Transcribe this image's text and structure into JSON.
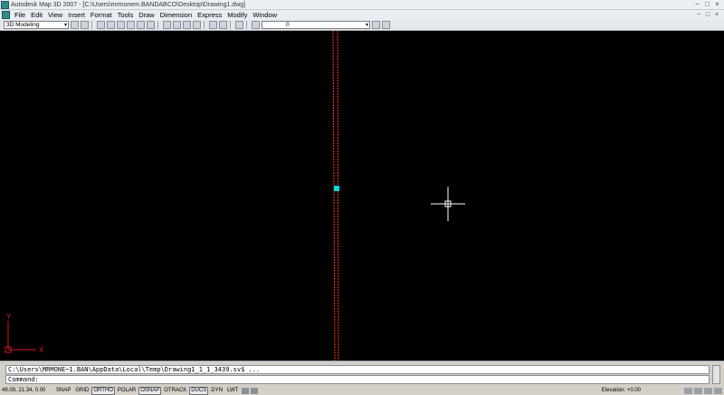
{
  "window": {
    "title": "Autodesk Map 3D 2007 - [C:\\Users\\mrmonem.BANDABCO\\Desktop\\Drawing1.dwg]",
    "icon": "autodesk-map-icon",
    "controls": [
      "−",
      "□",
      "×"
    ]
  },
  "menubar": {
    "items": [
      "File",
      "Edit",
      "View",
      "Insert",
      "Format",
      "Tools",
      "Draw",
      "Dimension",
      "Express",
      "Modify",
      "Window"
    ],
    "doc_controls": [
      "−",
      "□",
      "×"
    ]
  },
  "toolbar": {
    "workspace": "3D Modeling",
    "layer": "0"
  },
  "canvas": {
    "background": "#000000",
    "ucs_y_label": "Y",
    "ucs_x_label": "X",
    "line_color": "#ff3b1f",
    "grip_color": "#00d9d9",
    "ucs_color": "#d31a1a",
    "cursor_color": "#ffffff"
  },
  "command": {
    "history": "C:\\Users\\MRMONE~1.BAN\\AppData\\Local\\Temp\\Drawing1_1_1_3439.sv$ ...",
    "prompt": "Command:"
  },
  "status": {
    "coordinates": "49.09, 21.34, 0.00",
    "toggles": [
      {
        "label": "SNAP",
        "on": false
      },
      {
        "label": "GRID",
        "on": false
      },
      {
        "label": "ORTHO",
        "on": true
      },
      {
        "label": "POLAR",
        "on": false
      },
      {
        "label": "OSNAP",
        "on": true
      },
      {
        "label": "OTRACK",
        "on": false
      },
      {
        "label": "DUCS",
        "on": true
      },
      {
        "label": "DYN",
        "on": false
      },
      {
        "label": "LWT",
        "on": false
      }
    ],
    "elevation": "Elevation: +0.00"
  }
}
